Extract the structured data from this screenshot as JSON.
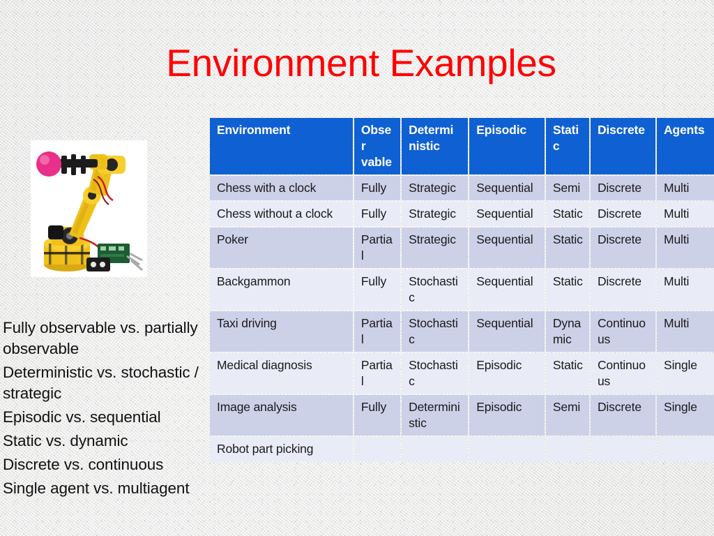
{
  "slide": {
    "title": "Environment Examples",
    "title_color": "#ff0000",
    "background_color": "#ececeb"
  },
  "figure": {
    "name": "robotic-arm-photo",
    "alt": "Yellow industrial robotic arm gripping a pink ball",
    "robot_body_color": "#f2c21a",
    "robot_joint_color": "#1c1c1c",
    "ball_color": "#e8308a"
  },
  "left_list": {
    "items": [
      "Fully observable vs. partially observable",
      "Deterministic vs. stochastic / strategic",
      "Episodic vs. sequential",
      "Static vs. dynamic",
      "Discrete vs. continuous",
      "Single agent vs. multiagent"
    ]
  },
  "table": {
    "header_bg": "#0f60d2",
    "header_text_color": "#ffffff",
    "row_dark_bg": "#ccd1e8",
    "row_light_bg": "#e9ecf7",
    "columns": [
      "Environment",
      "Obser vable",
      "Determi nistic",
      "Episodic",
      "Static",
      "Discrete",
      "Agents"
    ],
    "rows": [
      {
        "environment": "Chess with a clock",
        "observable": "Fully",
        "deterministic": "Strategic",
        "episodic": "Sequential",
        "static": "Semi",
        "discrete": "Discrete",
        "agents": "Multi"
      },
      {
        "environment": "Chess without a clock",
        "observable": "Fully",
        "deterministic": "Strategic",
        "episodic": "Sequential",
        "static": "Static",
        "discrete": "Discrete",
        "agents": "Multi"
      },
      {
        "environment": "Poker",
        "observable": "Partial",
        "deterministic": "Strategic",
        "episodic": "Sequential",
        "static": "Static",
        "discrete": "Discrete",
        "agents": "Multi"
      },
      {
        "environment": "Backgammon",
        "observable": "Fully",
        "deterministic": "Stochastic",
        "episodic": "Sequential",
        "static": "Static",
        "discrete": "Discrete",
        "agents": "Multi"
      },
      {
        "environment": "Taxi driving",
        "observable": "Partial",
        "deterministic": "Stochastic",
        "episodic": "Sequential",
        "static": "Dynamic",
        "discrete": "Continuous",
        "agents": "Multi"
      },
      {
        "environment": "Medical diagnosis",
        "observable": "Partial",
        "deterministic": "Stochastic",
        "episodic": "Episodic",
        "static": "Static",
        "discrete": "Continuous",
        "agents": "Single"
      },
      {
        "environment": "Image analysis",
        "observable": "Fully",
        "deterministic": "Deterministic",
        "episodic": "Episodic",
        "static": "Semi",
        "discrete": "Discrete",
        "agents": "Single"
      },
      {
        "environment": "Robot part picking",
        "observable": "",
        "deterministic": "",
        "episodic": "",
        "static": "",
        "discrete": "",
        "agents": ""
      }
    ]
  }
}
